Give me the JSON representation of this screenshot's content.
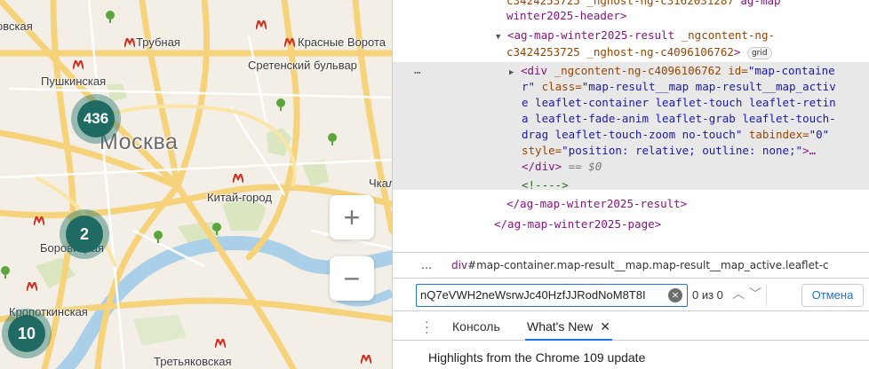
{
  "map": {
    "labels": {
      "kovskaya": "овская",
      "trubnaya": "Трубная",
      "krasnye_vorota": "Красные Ворота",
      "sretensky": "Сретенский бульвар",
      "pushkinskaya": "Пушкинская",
      "moskva": "Москва",
      "kitay_gorod": "Китай-город",
      "chkal": "Чкал",
      "borovitskaya": "Боровицкая",
      "kropotkinskaya": "Кропоткинская",
      "tretyakovskaya": "Третьяковская"
    },
    "clusters": {
      "c436": "436",
      "c2": "2",
      "c10": "10"
    },
    "zoom_in": "+",
    "zoom_out": "−",
    "colors": {
      "cluster": "#1f6b63",
      "metro": "#d52b1e",
      "road": "#f6d27a",
      "river": "#a9d0e8",
      "park": "#cfe3b3"
    }
  },
  "devtools": {
    "lines": {
      "l0_a": "c3424253725 _nghost-ng-c3162031287",
      "l0_b": "ag-map",
      "l1": "winter2025-header>",
      "l2_tag": "<ag-map-winter2025-result",
      "l2_attr": " _ngcontent-ng-",
      "l3_attr": "c3424253725 _nghost-ng-c4096106762",
      "l3_end": ">",
      "badge": "grid",
      "l4_tag": "<div",
      "l4_attr": " _ngcontent-ng-c4096106762 id=",
      "l4_val": "\"map-containe",
      "l5_val": "r\"",
      "l5_attr": " class=",
      "l5_val2": "\"map-result__map map-result__map_activ",
      "l6": "e leaflet-container leaflet-touch leaflet-retin",
      "l7": "a leaflet-fade-anim leaflet-grab leaflet-touch-",
      "l8": "drag leaflet-touch-zoom no-touch\"",
      "l8_attr": " tabindex=",
      "l8_val": "\"0\"",
      "l9_attr": "style=",
      "l9_val": "\"position: relative; outline: none;\"",
      "l9_end": ">…",
      "l10_tag": "</div>",
      "l10_eq": " == ",
      "l10_var": "$0",
      "l11": "<!---->",
      "l12": "</ag-map-winter2025-result>",
      "l13": "</ag-map-winter2025-page>",
      "dots": "…"
    },
    "breadcrumb": {
      "dots": "…",
      "tag": "div",
      "rest": "#map-container.map-result__map.map-result__map_active.leaflet-c"
    },
    "search": {
      "value": "nQ7eVWH2neWsrwJc40HzfJJRodNoM8T8I",
      "clear": "×",
      "count": "0 из 0",
      "up": "︿",
      "down": "﹀",
      "cancel": "Отмена"
    },
    "drawer": {
      "tab_console": "Консоль",
      "tab_whatsnew": "What's New",
      "close": "✕",
      "body": "Highlights from the Chrome 109 update"
    }
  }
}
